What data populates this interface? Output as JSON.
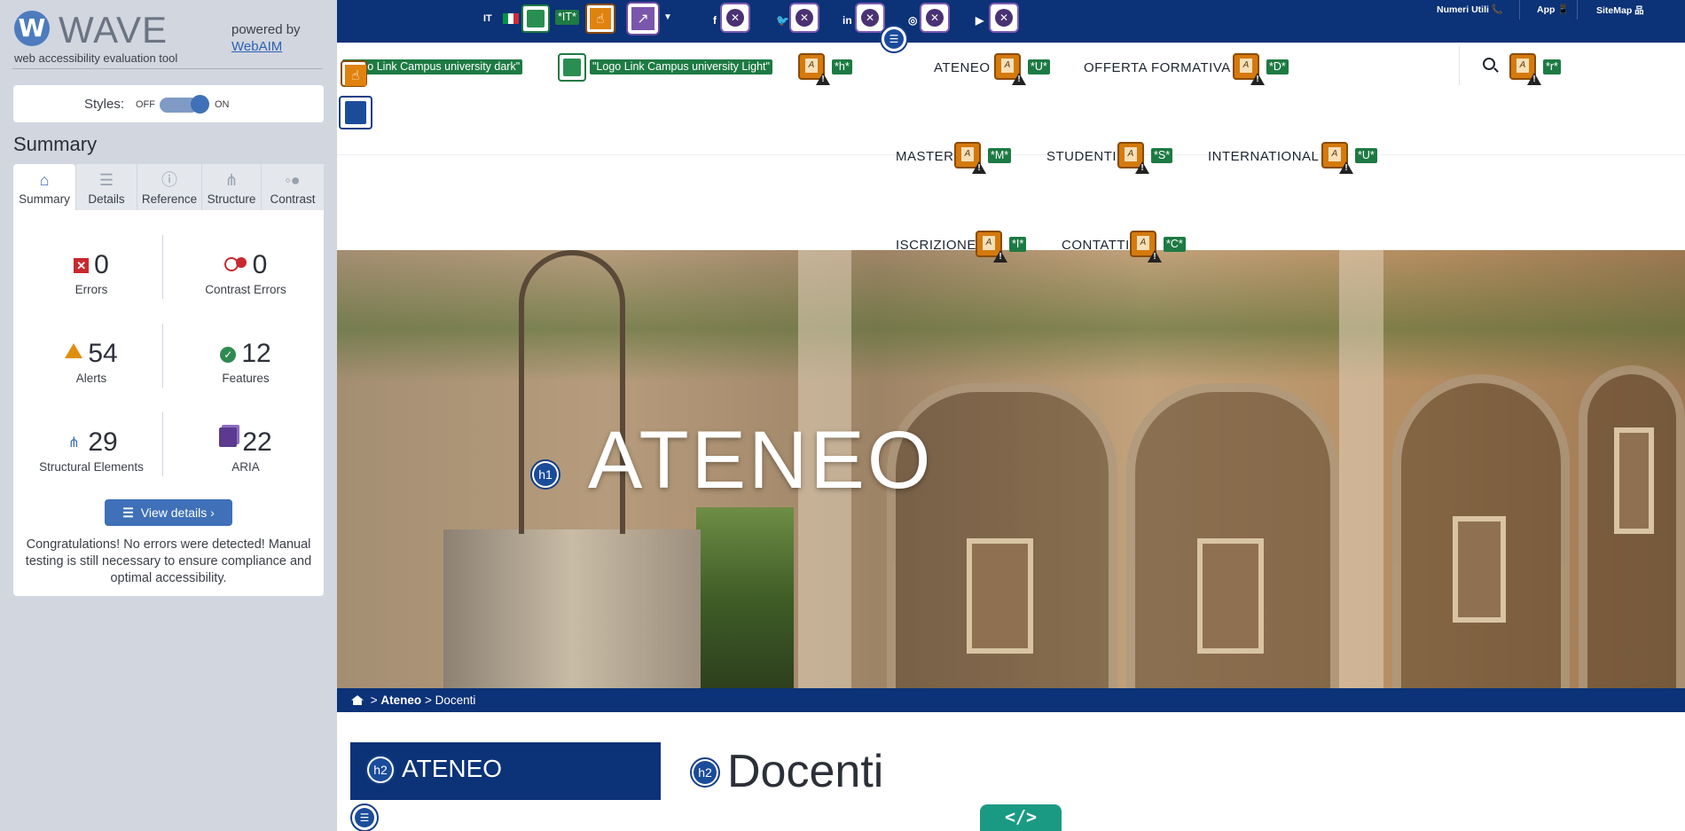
{
  "wave": {
    "logo_letter": "W",
    "logo_text": "WAVE",
    "tagline": "web accessibility evaluation tool",
    "powered_by": "powered by",
    "webaim_link": "WebAIM",
    "styles_label": "Styles:",
    "styles_off": "OFF",
    "styles_on": "ON",
    "summary_title": "Summary",
    "tabs": [
      {
        "label": "Summary",
        "icon": "home-icon",
        "glyph": "⌂"
      },
      {
        "label": "Details",
        "icon": "list-icon",
        "glyph": "☰"
      },
      {
        "label": "Reference",
        "icon": "info-icon",
        "glyph": "ⓘ"
      },
      {
        "label": "Structure",
        "icon": "structure-icon",
        "glyph": "⋔"
      },
      {
        "label": "Contrast",
        "icon": "contrast-icon",
        "glyph": "◦●"
      }
    ],
    "stats": {
      "errors": {
        "value": "0",
        "label": "Errors"
      },
      "contrast": {
        "value": "0",
        "label": "Contrast Errors"
      },
      "alerts": {
        "value": "54",
        "label": "Alerts"
      },
      "features": {
        "value": "12",
        "label": "Features"
      },
      "structural": {
        "value": "29",
        "label": "Structural Elements"
      },
      "aria": {
        "value": "22",
        "label": "ARIA"
      }
    },
    "view_details": "View details ›",
    "congrats": "Congratulations! No errors were detected! Manual testing is still necessary to ensure compliance and optimal accessibility."
  },
  "site": {
    "lang": "IT",
    "wave_labels": {
      "lang_it": "*IT*",
      "logo_dark": "\"Logo Link Campus university dark\"",
      "logo_light": "\"Logo Link Campus university Light\"",
      "h": "*h*",
      "ateneo": "*U*",
      "offerta": "*D*",
      "search": "*r*",
      "master": "*M*",
      "studenti": "*S*",
      "international": "*U*",
      "iscrizione": "*I*",
      "contatti": "*C*",
      "h1": "h1",
      "h2": "h2",
      "code": "</>"
    },
    "social": [
      "f",
      "🐦",
      "in",
      "◎",
      "▶"
    ],
    "top_links": [
      "Numeri Utili 📞",
      "App 📱",
      "SiteMap 品"
    ],
    "nav": {
      "ateneo": "ATENEO",
      "offerta": "OFFERTA FORMATIVA",
      "master": "MASTER",
      "studenti": "STUDENTI",
      "international": "INTERNATIONAL",
      "iscrizione": "ISCRIZIONE",
      "contatti": "CONTATTI"
    },
    "hero_title": "ATENEO",
    "breadcrumb": {
      "sep": ">",
      "ateneo": "Ateneo",
      "current": "Docenti"
    },
    "side_title": "ATENEO",
    "main_title": "Docenti"
  },
  "colors": {
    "navy": "#0c3277",
    "wave_blue": "#3f70b8",
    "error_red": "#c8292e",
    "alert_orange": "#e08e10",
    "feature_green": "#2f8a4f",
    "aria_purple": "#5b3a8f"
  }
}
